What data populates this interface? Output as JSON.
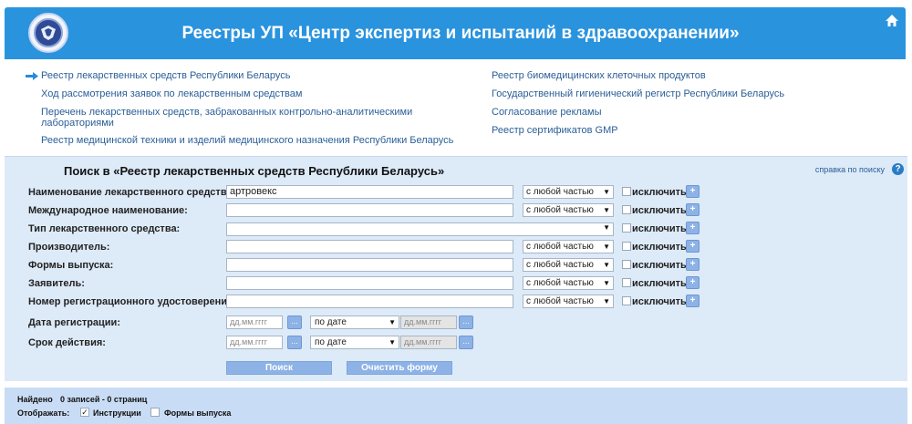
{
  "header": {
    "title": "Реестры УП «Центр экспертиз и испытаний в здравоохранении»"
  },
  "links": {
    "left": [
      "Реестр лекарственных средств Республики Беларусь",
      "Ход рассмотрения заявок по лекарственным средствам",
      "Перечень лекарственных средств, забракованных контрольно-аналитическими",
      "лабораториями",
      "Реестр медицинской техники и изделий медицинского назначения Республики Беларусь"
    ],
    "right": [
      "Реестр биомедицинских клеточных продуктов",
      "Государственный гигиенический регистр Республики Беларусь",
      "Согласование рекламы",
      "Реестр сертификатов GMP"
    ]
  },
  "search": {
    "title": "Поиск в «Реестр лекарственных средств Республики Беларусь»",
    "help": "справка по поиску",
    "help_icon": "?",
    "fields": [
      {
        "label": "Наименование лекарственного средства:",
        "value": "артровекс",
        "mode": "с любой частью"
      },
      {
        "label": "Международное наименование:",
        "value": "",
        "mode": "с любой частью"
      },
      {
        "label": "Тип лекарственного средства:",
        "value": "",
        "mode": ""
      },
      {
        "label": "Производитель:",
        "value": "",
        "mode": "с любой частью"
      },
      {
        "label": "Формы выпуска:",
        "value": "",
        "mode": "с любой частью"
      },
      {
        "label": "Заявитель:",
        "value": "",
        "mode": "с любой частью"
      },
      {
        "label": "Номер регистрационного удостоверения:",
        "value": "",
        "mode": "с любой частью"
      }
    ],
    "exclude_label": "исключить",
    "plus": "+",
    "reg_date_label": "Дата регистрации:",
    "validity_label": "Срок действия:",
    "date_placeholder": "дд.мм.гггг",
    "date_btn": "...",
    "date_mode": "по дате",
    "caret": "▼",
    "search_btn": "Поиск",
    "clear_btn": "Очистить форму"
  },
  "results": {
    "found_label": "Найдено",
    "found_value": "0 записей - 0 страниц",
    "display_label": "Отображать:",
    "instructions": "Инструкции",
    "instructions_checked": true,
    "check_mark": "✓",
    "forms": "Формы выпуска",
    "forms_checked": false
  },
  "colors": {
    "header": "#2a93de",
    "link": "#2a5e97",
    "panel": "#ddeaf8",
    "button": "#8db2e6",
    "results": "#c9dcf5"
  }
}
